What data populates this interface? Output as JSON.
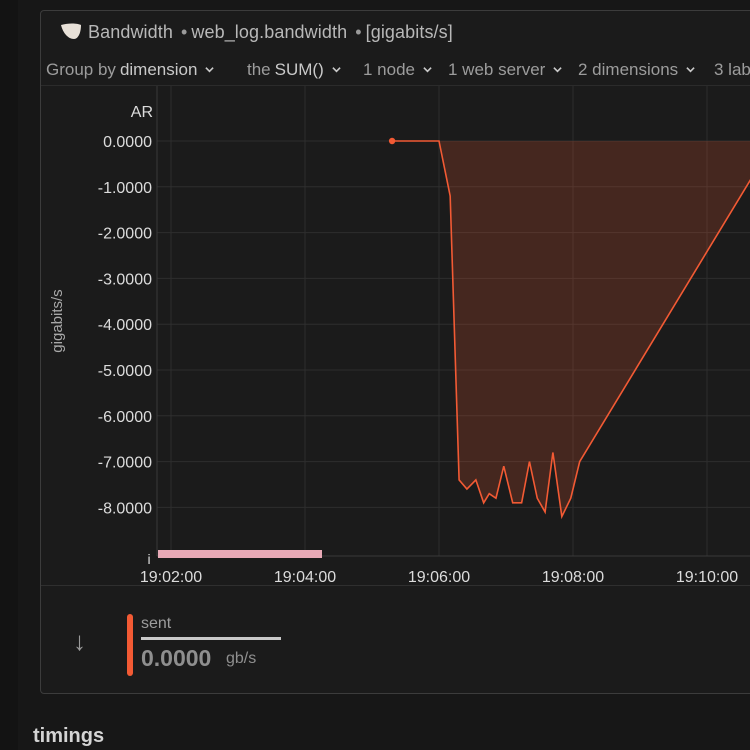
{
  "header": {
    "icon": "chart-area-icon",
    "title": "Bandwidth",
    "context": "web_log.bandwidth",
    "units": "[gigabits/s]"
  },
  "toolbar": {
    "group_by_prefix": "Group by",
    "group_by_value": "dimension",
    "aggregation_prefix": "the",
    "aggregation_value": "SUM()",
    "nodes": "1 node",
    "instances": "1 web server",
    "dimensions": "2 dimensions",
    "labels": "3 lab"
  },
  "chart_data": {
    "type": "area",
    "ylabel": "gigabits/s",
    "annotation_label": "AR",
    "ylim": [
      -9.0,
      0.3
    ],
    "y_ticks": [
      "0.0000",
      "-1.0000",
      "-2.0000",
      "-3.0000",
      "-4.0000",
      "-5.0000",
      "-6.0000",
      "-7.0000",
      "-8.0000"
    ],
    "x_ticks": [
      "19:02:00",
      "19:04:00",
      "19:06:00",
      "19:08:00",
      "19:10:00"
    ],
    "x_window_seconds": [
      1,
      600
    ],
    "annotation_marker": "i",
    "series": [
      {
        "name": "sent",
        "color": "#f25a34",
        "x": [
          258,
          300,
          310,
          318,
          325,
          333,
          340,
          345,
          351,
          358,
          366,
          374,
          381,
          388,
          395,
          402,
          410,
          418,
          426,
          600
        ],
        "y": [
          0.0,
          0.0,
          -1.2,
          -7.4,
          -7.6,
          -7.4,
          -7.9,
          -7.7,
          -7.8,
          -7.1,
          -7.9,
          -7.9,
          -7.0,
          -7.8,
          -8.1,
          -6.8,
          -8.2,
          -7.8,
          -7.0,
          0.0
        ]
      }
    ]
  },
  "legend": {
    "arrow": "↓",
    "series_name": "sent",
    "value": "0.0000",
    "unit": "gb/s"
  },
  "section": {
    "title": "timings"
  }
}
